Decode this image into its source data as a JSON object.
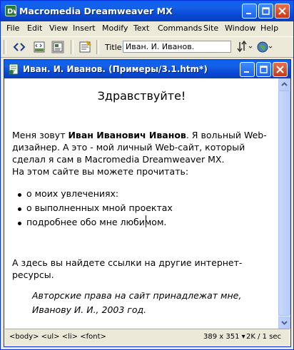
{
  "app": {
    "title": "Macromedia Dreamweaver MX",
    "menu": [
      "File",
      "Edit",
      "View",
      "Insert",
      "Modify",
      "Text",
      "Commands",
      "Site",
      "Window",
      "Help"
    ],
    "toolbar": {
      "title_label": "Title:",
      "title_value": "Иван. И. Иванов."
    }
  },
  "document": {
    "window_title": "Иван. И. Иванов. (Примеры/3.1.htm*)",
    "heading": "Здравствуйте!",
    "intro_before": "Меня зовут ",
    "intro_bold": "Иван Иванович Иванов",
    "intro_after": ". Я вольный Web-дизайнер. А это - мой личный Web-сайт, который сделал я сам в Macromedia Dreamweaver MX.",
    "intro_line2": "На этом сайте вы можете прочитать:",
    "list": [
      "о моих увлечениях:",
      "о выполненных мной проектах",
      "подробнее обо мне любимом."
    ],
    "links_text": "А здесь вы найдете ссылки на другие интернет-ресурсы.",
    "copyright": "Авторские права на сайт принадлежат мне, Иванову И. И., 2003 год."
  },
  "status": {
    "tags": "<body> <ul> <li> <font>",
    "window_size": "389 x 351 ▾",
    "download": "2K / 1 sec"
  },
  "colors": {
    "titlebar": "#0a5fef",
    "chrome": "#ece9d8",
    "close_button": "#c73a1a"
  }
}
